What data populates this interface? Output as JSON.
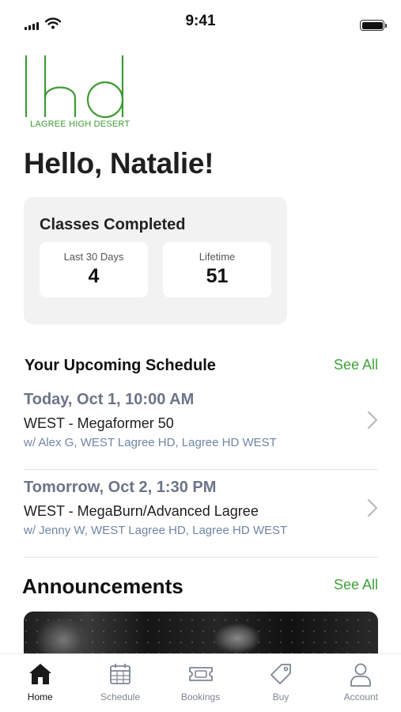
{
  "status_bar": {
    "time": "9:41"
  },
  "brand": {
    "logo_text": "lhd",
    "logo_subtitle": "LAGREE HIGH DESERT",
    "color": "#3e9a34"
  },
  "greeting": "Hello, Natalie!",
  "classes_completed": {
    "title": "Classes Completed",
    "stats": [
      {
        "label": "Last 30 Days",
        "value": "4"
      },
      {
        "label": "Lifetime",
        "value": "51"
      }
    ]
  },
  "schedule": {
    "title": "Your Upcoming Schedule",
    "see_all": "See All",
    "items": [
      {
        "date": "Today, Oct 1, 10:00 AM",
        "class_name": "WEST - Megaformer 50",
        "details": "w/ Alex G, WEST Lagree HD, Lagree HD WEST"
      },
      {
        "date": "Tomorrow, Oct 2, 1:30 PM",
        "class_name": "WEST - MegaBurn/Advanced Lagree",
        "details": "w/ Jenny W, WEST Lagree HD, Lagree HD WEST"
      }
    ]
  },
  "announcements": {
    "title": "Announcements",
    "see_all": "See All"
  },
  "tabs": [
    {
      "label": "Home",
      "icon": "home-icon",
      "active": true
    },
    {
      "label": "Schedule",
      "icon": "calendar-icon",
      "active": false
    },
    {
      "label": "Bookings",
      "icon": "ticket-icon",
      "active": false
    },
    {
      "label": "Buy",
      "icon": "tag-icon",
      "active": false
    },
    {
      "label": "Account",
      "icon": "person-icon",
      "active": false
    }
  ],
  "colors": {
    "accent": "#3fa239",
    "date_text": "#6c7488",
    "detail_text": "#6f86a4",
    "tab_inactive": "#7d8595"
  }
}
